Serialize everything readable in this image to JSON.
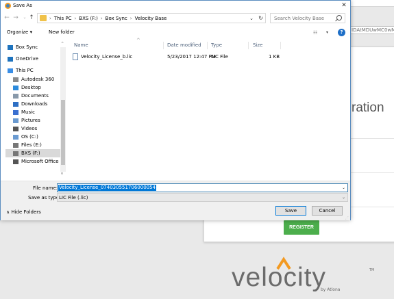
{
  "dialog": {
    "title": "Save As",
    "close_glyph": "✕",
    "nav": {
      "back_glyph": "←",
      "forward_glyph": "→",
      "recent_glyph": "⌄",
      "up_glyph": "↑"
    },
    "breadcrumb": [
      "This PC",
      "BXS (F:)",
      "Box Sync",
      "Velocity Base"
    ],
    "breadcrumb_sep": "›",
    "search_placeholder": "Search Velocity Base",
    "toolbar": {
      "organize": "Organize ▾",
      "new_folder": "New folder",
      "view_glyph": "☷",
      "help_glyph": "?"
    },
    "nav_pane": [
      {
        "label": "Box Sync",
        "icon": "box-sync-icon",
        "indent": false,
        "color": "#1e73be"
      },
      {
        "label": "OneDrive",
        "icon": "onedrive-icon",
        "indent": false,
        "color": "#1e73be"
      },
      {
        "label": "This PC",
        "icon": "this-pc-icon",
        "indent": false,
        "color": "#3a8ee6"
      },
      {
        "label": "Autodesk 360",
        "icon": "autodesk-icon",
        "indent": true,
        "color": "#8a8a8a"
      },
      {
        "label": "Desktop",
        "icon": "desktop-icon",
        "indent": true,
        "color": "#2d8bdc"
      },
      {
        "label": "Documents",
        "icon": "documents-icon",
        "indent": true,
        "color": "#8899aa"
      },
      {
        "label": "Downloads",
        "icon": "downloads-icon",
        "indent": true,
        "color": "#2d6fc4"
      },
      {
        "label": "Music",
        "icon": "music-icon",
        "indent": true,
        "color": "#3a6fd0"
      },
      {
        "label": "Pictures",
        "icon": "pictures-icon",
        "indent": true,
        "color": "#6a9ad0"
      },
      {
        "label": "Videos",
        "icon": "videos-icon",
        "indent": true,
        "color": "#555555"
      },
      {
        "label": "OS (C:)",
        "icon": "drive-icon",
        "indent": true,
        "color": "#6b9bd1"
      },
      {
        "label": "Files (E:)",
        "icon": "drive-icon",
        "indent": true,
        "color": "#777777"
      },
      {
        "label": "BXS (F:)",
        "icon": "drive-icon",
        "indent": true,
        "color": "#777777",
        "selected": true
      },
      {
        "label": "Microsoft Office",
        "icon": "office-icon",
        "indent": true,
        "color": "#555555"
      }
    ],
    "columns": {
      "name": "Name",
      "date": "Date modified",
      "type": "Type",
      "size": "Size",
      "sort_glyph": "^"
    },
    "files": [
      {
        "name": "Velocity_License_b.lic",
        "date": "5/23/2017 12:47 PM",
        "type": "LIC File",
        "size": "1 KB"
      }
    ],
    "filename_label": "File name:",
    "filename_value": "Velocity_License_074030551706000054",
    "savetype_label": "Save as type:",
    "savetype_value": "LIC File (.lic)",
    "dropdown_glyph": "⌄",
    "hide_folders": "∧  Hide Folders",
    "save_label": "Save",
    "cancel_label": "Cancel"
  },
  "background": {
    "url_fragment": "IDAtMDUwMC0wMDA",
    "heading_fragment": "ration",
    "register_label": "REGISTER",
    "logo_text": "velocity",
    "logo_sub": "by Atlona",
    "logo_tm": "TM"
  }
}
